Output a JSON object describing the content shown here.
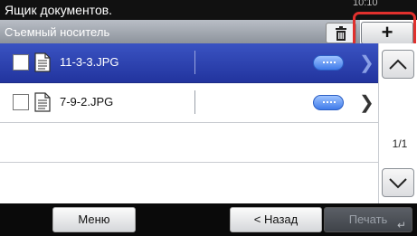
{
  "window": {
    "title": "Ящик документов.",
    "clock": "10:10"
  },
  "header": {
    "location": "Съемный носитель",
    "add_label": "+"
  },
  "files": [
    {
      "name": "11-3-3.JPG",
      "selected": true
    },
    {
      "name": "7-9-2.JPG",
      "selected": false
    }
  ],
  "pager": {
    "page": "1/1"
  },
  "footer": {
    "menu_label": "Меню",
    "back_label": "< Назад",
    "print_label": "Печать"
  },
  "colors": {
    "highlight": "#e0302d",
    "selected_row": "#2a3fb0"
  },
  "icons": {
    "delete": "trash-icon",
    "add": "plus-icon",
    "file": "document-icon"
  }
}
